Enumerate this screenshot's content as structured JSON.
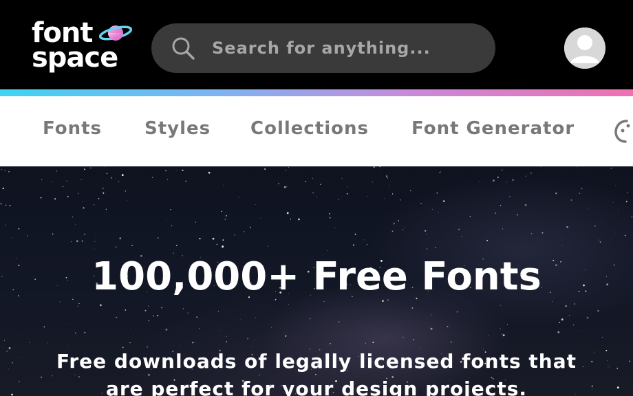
{
  "header": {
    "logo": {
      "line1": "font",
      "line2": "space"
    },
    "search": {
      "placeholder": "Search for anything..."
    }
  },
  "nav": {
    "items": [
      {
        "label": "Fonts"
      },
      {
        "label": "Styles"
      },
      {
        "label": "Collections"
      },
      {
        "label": "Font Generator"
      }
    ]
  },
  "hero": {
    "title": "100,000+ Free Fonts",
    "subtitle": "Free downloads of legally licensed fonts that are perfect for your design projects."
  },
  "colors": {
    "accent_gradient": [
      "#3fd3f4",
      "#c78ad8",
      "#f06fb1"
    ],
    "topbar_bg": "#000000",
    "search_bg": "#3a3a3a",
    "nav_text": "#787878"
  },
  "icons": [
    "planet-icon",
    "search-icon",
    "user-avatar-icon",
    "more-icon"
  ]
}
